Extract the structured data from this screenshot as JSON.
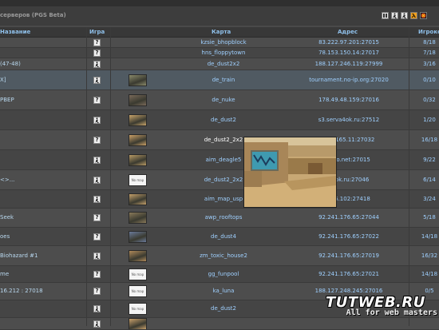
{
  "page": {
    "title": "серверов (PGS Beta)"
  },
  "filters": [
    {
      "icon": "hl-filter-icon",
      "label": "HL"
    },
    {
      "icon": "cs-filter-icon",
      "label": "CS"
    },
    {
      "icon": "cs-filter-icon-2",
      "label": "CS"
    },
    {
      "icon": "halflife-filter-icon",
      "label": "λ"
    },
    {
      "icon": "other-game-filter-icon",
      "label": ""
    }
  ],
  "columns": {
    "name": "Название",
    "game": "Игра",
    "map": "Карта",
    "address": "Адрес",
    "players": "Игроко"
  },
  "rows": [
    {
      "name": "",
      "tag": "",
      "game": "?",
      "thumb": false,
      "map": "kzsie_bhopblock",
      "address": "83.222.97.201:27015",
      "players": "8/18"
    },
    {
      "name": "",
      "tag": "",
      "game": "?",
      "thumb": false,
      "map": "hns_floppytown",
      "address": "78.153.150.14:27017",
      "players": "7/18"
    },
    {
      "name": "(47-48)",
      "tag": "",
      "game": "cs",
      "thumb": false,
      "map": "de_dust2x2",
      "address": "188.127.246.119:27999",
      "players": "3/16"
    },
    {
      "name": "X]",
      "tag": "",
      "game": "cs",
      "thumb": true,
      "map": "de_train",
      "address": "tournament.no-ip.org:27020",
      "players": "0/10"
    },
    {
      "name": "PBEP",
      "tag": "",
      "game": "?",
      "thumb": true,
      "map": "de_nuke",
      "address": "178.49.48.159:27016",
      "players": "0/32"
    },
    {
      "name": "",
      "tag": "",
      "game": "cs",
      "thumb": true,
      "map": "de_dust2",
      "address": "s3.serva4ok.ru:27512",
      "players": "1/20"
    },
    {
      "name": "",
      "tag": "",
      "game": "?",
      "thumb": true,
      "map": "de_dust2_2x2",
      "address": "188.165.11:27032",
      "players": "16/18"
    },
    {
      "name": "",
      "tag": "",
      "game": "cs",
      "thumb": true,
      "map": "aim_deagle5",
      "address": "tevo.net:27015",
      "players": "9/22"
    },
    {
      "name": "<>...",
      "tag": "",
      "game": "cs",
      "thumb": true,
      "map": "de_dust2_2x2",
      "address": "s4ok.ru:27046",
      "players": "6/14"
    },
    {
      "name": "",
      "tag": "",
      "game": "cs",
      "thumb": true,
      "map": "aim_map_usp",
      "address": "246.102:27418",
      "players": "3/24"
    },
    {
      "name": "Seek",
      "tag": "",
      "game": "?",
      "thumb": true,
      "map": "awp_rooftops",
      "address": "92.241.176.65:27044",
      "players": "5/18"
    },
    {
      "name": "oes",
      "tag": "",
      "game": "?",
      "thumb": true,
      "map": "de_dust4",
      "address": "92.241.176.65:27022",
      "players": "14/18"
    },
    {
      "name": "Biohazard #1",
      "tag": "",
      "game": "cs",
      "thumb": true,
      "map": "zm_toxic_house2",
      "address": "92.241.176.65:27019",
      "players": "16/32"
    },
    {
      "name": "me",
      "tag": "",
      "game": "?",
      "thumb": true,
      "map": "gg_funpool",
      "address": "92.241.176.65:27021",
      "players": "14/18"
    },
    {
      "name": "16.212 : 27018",
      "tag": "",
      "game": "?",
      "thumb": true,
      "map": "ka_luna",
      "address": "188.127.248.245:27016",
      "players": "0/5"
    },
    {
      "name": "",
      "tag": "",
      "game": "cs",
      "thumb": true,
      "map": "de_dust2",
      "address": "",
      "players": ""
    },
    {
      "name": "",
      "tag": "",
      "game": "cs",
      "thumb": true,
      "map": "",
      "address": "",
      "players": ""
    }
  ],
  "watermark": {
    "main": "TUTWEB.RU",
    "sub": "All for web masters"
  }
}
